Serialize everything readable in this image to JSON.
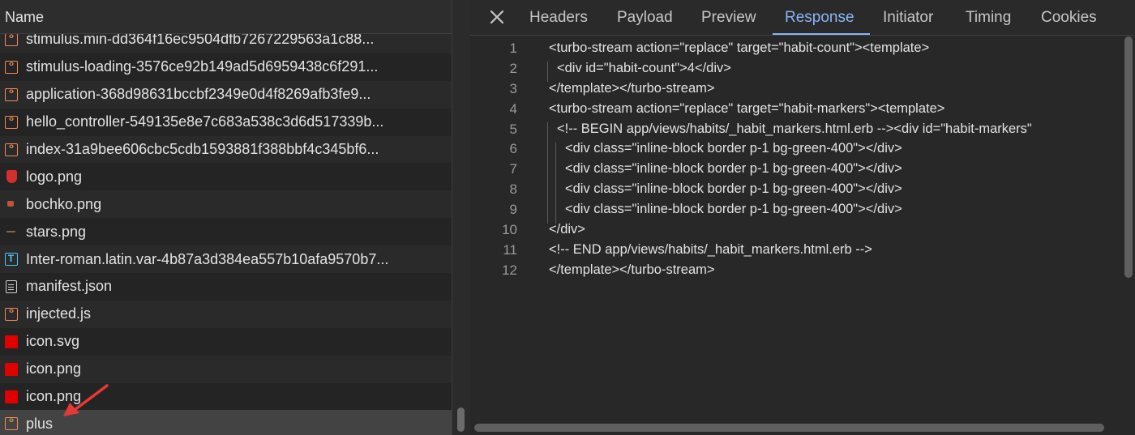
{
  "left_panel": {
    "column_header": "Name",
    "requests": [
      {
        "name": "stimulus.min-dd364f16ec9504dfb7267229563a1c88...",
        "icon": "script-icon"
      },
      {
        "name": "stimulus-loading-3576ce92b149ad5d6959438c6f291...",
        "icon": "script-icon"
      },
      {
        "name": "application-368d98631bccbf2349e0d4f8269afb3fe9...",
        "icon": "script-icon"
      },
      {
        "name": "hello_controller-549135e8e7c683a538c3d6d517339b...",
        "icon": "script-icon"
      },
      {
        "name": "index-31a9bee606cbc5cdb1593881f388bbf4c345bf6...",
        "icon": "script-icon"
      },
      {
        "name": "logo.png",
        "icon": "shield-image-icon"
      },
      {
        "name": "bochko.png",
        "icon": "image-icon"
      },
      {
        "name": "stars.png",
        "icon": "image-icon"
      },
      {
        "name": "Inter-roman.latin.var-4b87a3d384ea557b10afa9570b7...",
        "icon": "font-icon"
      },
      {
        "name": "manifest.json",
        "icon": "document-icon"
      },
      {
        "name": "injected.js",
        "icon": "script-icon"
      },
      {
        "name": "icon.svg",
        "icon": "red-image-icon"
      },
      {
        "name": "icon.png",
        "icon": "red-image-icon"
      },
      {
        "name": "icon.png",
        "icon": "red-image-icon"
      },
      {
        "name": "plus",
        "icon": "script-icon"
      }
    ]
  },
  "detail_panel": {
    "tabs": [
      "Headers",
      "Payload",
      "Preview",
      "Response",
      "Initiator",
      "Timing",
      "Cookies"
    ],
    "active_tab": "Response",
    "accent_color": "#8ab4f8",
    "response_lines": [
      {
        "num": "1",
        "text": "<turbo-stream action=\"replace\" target=\"habit-count\"><template>"
      },
      {
        "num": "2",
        "text": "<div id=\"habit-count\">4</div>"
      },
      {
        "num": "3",
        "text": "</template></turbo-stream>"
      },
      {
        "num": "4",
        "text": "<turbo-stream action=\"replace\" target=\"habit-markers\"><template>"
      },
      {
        "num": "5",
        "text": "<!-- BEGIN app/views/habits/_habit_markers.html.erb --><div id=\"habit-markers\""
      },
      {
        "num": "6",
        "text": "<div class=\"inline-block border p-1 bg-green-400\"></div>"
      },
      {
        "num": "7",
        "text": "<div class=\"inline-block border p-1 bg-green-400\"></div>"
      },
      {
        "num": "8",
        "text": "<div class=\"inline-block border p-1 bg-green-400\"></div>"
      },
      {
        "num": "9",
        "text": "<div class=\"inline-block border p-1 bg-green-400\"></div>"
      },
      {
        "num": "10",
        "text": "</div>"
      },
      {
        "num": "11",
        "text": "<!-- END app/views/habits/_habit_markers.html.erb -->"
      },
      {
        "num": "12",
        "text": "</template></turbo-stream>"
      }
    ]
  }
}
